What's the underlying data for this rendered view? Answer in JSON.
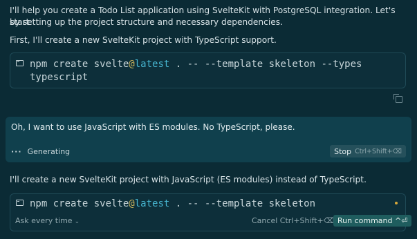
{
  "assistant": {
    "intro_line1": "I'll help you create a Todo List application using SvelteKit with PostgreSQL integration. Let's start",
    "intro_line2": "by setting up the project structure and necessary dependencies.",
    "first_step": "First, I'll create a new SvelteKit project with TypeScript support.",
    "followup": "I'll create a new SvelteKit project with JavaScript (ES modules) instead of TypeScript."
  },
  "command1": {
    "prefix": "npm create svelte",
    "at": "@",
    "latest": "latest",
    "rest": " . -- --template skeleton --types",
    "line2": "typescript"
  },
  "user": {
    "message": "Oh, I want to use JavaScript with ES modules. No TypeScript, please.",
    "generating_label": "Generating",
    "stop_label": "Stop",
    "stop_shortcut": "Ctrl+Shift+⌫"
  },
  "command2": {
    "prefix": "npm create svelte",
    "at": "@",
    "latest": "latest",
    "rest": " . -- --template skeleton",
    "ask_label": "Ask every time",
    "cancel_label": "Cancel Ctrl+Shift+⌫",
    "run_label": "Run command ^⏎"
  },
  "colors": {
    "background": "#0b2b35",
    "user_panel": "#10404d",
    "accent_at": "#c9b35a",
    "accent_latest": "#47b6d1",
    "status_dot": "#d9a93a",
    "run_button": "#1f5d5e"
  },
  "icons": [
    "terminal-icon",
    "copy-icon",
    "chevron-down-icon",
    "status-dot"
  ]
}
